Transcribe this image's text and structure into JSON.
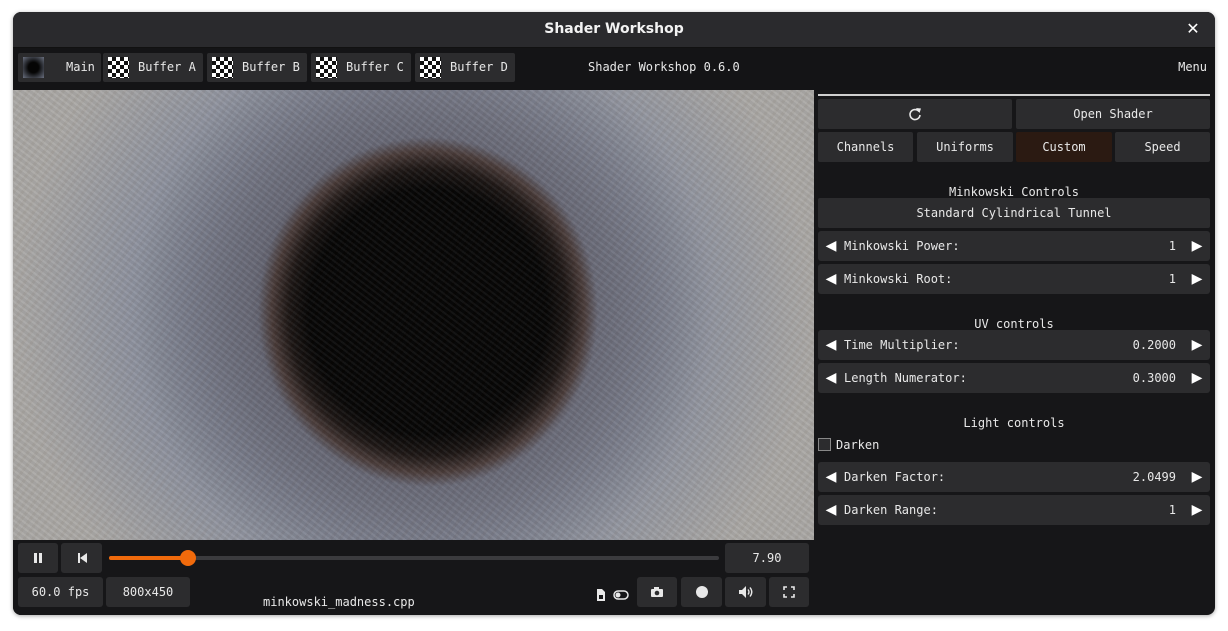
{
  "window": {
    "title": "Shader Workshop"
  },
  "tabs": [
    {
      "label": "Main",
      "thumb": "dark-preview"
    },
    {
      "label": "Buffer A",
      "thumb": "checkerboard"
    },
    {
      "label": "Buffer B",
      "thumb": "checkerboard"
    },
    {
      "label": "Buffer C",
      "thumb": "checkerboard"
    },
    {
      "label": "Buffer D",
      "thumb": "checkerboard"
    }
  ],
  "header": {
    "version": "Shader Workshop 0.6.0",
    "menu": "Menu"
  },
  "playback": {
    "time": "7.90",
    "progress_fraction": 0.13,
    "fps": "60.0 fps",
    "resolution": "800x450",
    "filename": "minkowski_madness.cpp",
    "icons": [
      "pause-icon",
      "restart-icon",
      "file-icon",
      "toggle-icon",
      "camera-icon",
      "record-icon",
      "volume-icon",
      "fullscreen-icon"
    ]
  },
  "panel": {
    "open_shader": "Open Shader",
    "tabs": [
      "Channels",
      "Uniforms",
      "Custom",
      "Speed"
    ],
    "active_tab": "Custom",
    "accent": "#f06a0c",
    "minkowski": {
      "header": "Minkowski Controls",
      "preset": "Standard Cylindrical Tunnel",
      "power": {
        "label": "Minkowski Power:",
        "value": "1"
      },
      "root": {
        "label": "Minkowski Root:",
        "value": "1"
      }
    },
    "uv": {
      "header": "UV controls",
      "time_mult": {
        "label": "Time Multiplier:",
        "value": "0.2000"
      },
      "length_num": {
        "label": "Length Numerator:",
        "value": "0.3000"
      }
    },
    "light": {
      "header": "Light controls",
      "darken_label": "Darken",
      "darken_checked": false,
      "factor": {
        "label": "Darken Factor:",
        "value": "2.0499"
      },
      "range": {
        "label": "Darken Range:",
        "value": "1"
      }
    }
  }
}
